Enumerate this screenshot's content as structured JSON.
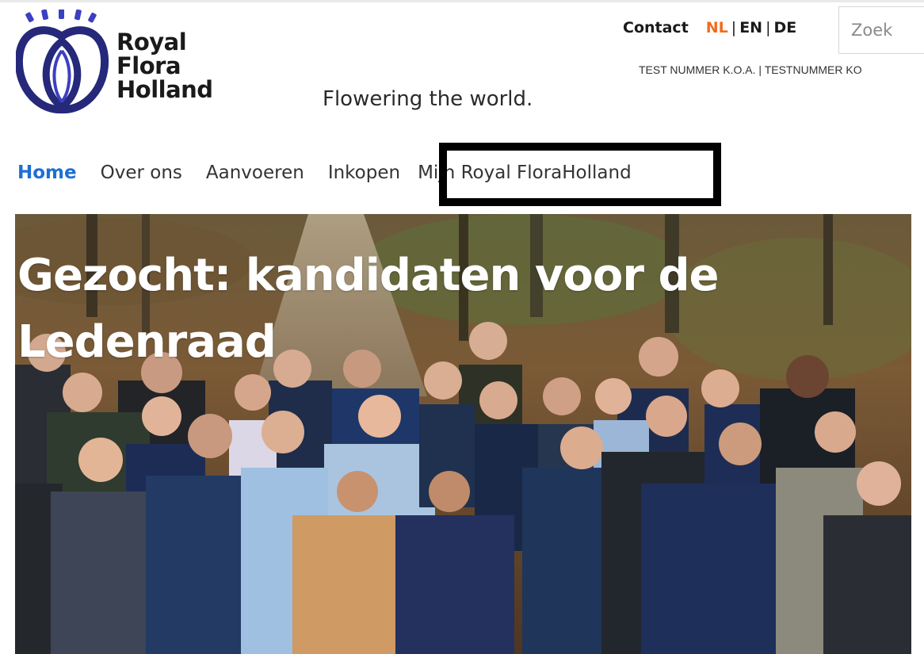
{
  "brand": {
    "name_line1": "Royal",
    "name_line2": "Flora",
    "name_line3": "Holland",
    "tagline": "Flowering the world.",
    "logo_icon": "royal-floraholland-logo-icon"
  },
  "utility": {
    "contact_label": "Contact",
    "languages": [
      "NL",
      "EN",
      "DE"
    ],
    "active_language": "NL",
    "separator": "|",
    "search_placeholder": "Zoek",
    "search_value": "",
    "test_numbers": "TEST NUMMER K.O.A. | TESTNUMMER KO"
  },
  "nav": {
    "items": [
      "Home",
      "Over ons",
      "Aanvoeren",
      "Inkopen",
      "Mijn Royal FloraHolland"
    ],
    "active": "Home",
    "highlighted": "Mijn Royal FloraHolland"
  },
  "hero": {
    "title": "Gezocht: kandidaten voor de Ledenraad",
    "image_subject": "group-photo"
  },
  "colors": {
    "accent_orange": "#f26b1d",
    "nav_active_blue": "#1d6fd6",
    "logo_navy": "#26287a",
    "logo_blue": "#3b3fc2"
  }
}
